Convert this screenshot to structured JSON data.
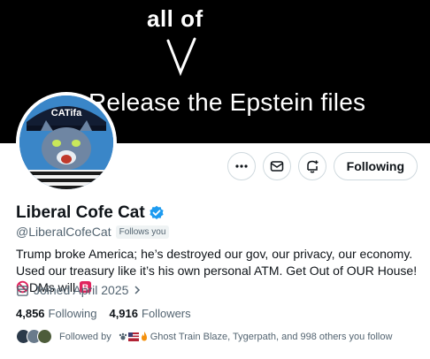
{
  "banner": {
    "top_text": "all of",
    "main_text": "Release the Epstein files"
  },
  "avatar": {
    "cap_text": "CATifa",
    "icon": "cat-avatar"
  },
  "actions": {
    "more_icon": "more-dots-icon",
    "message_icon": "envelope-icon",
    "notify_icon": "bell-plus-icon",
    "follow_label": "Following"
  },
  "profile": {
    "name": "Liberal Cofe Cat",
    "verified_icon": "verified-badge-icon",
    "handle": "@LiberalCofeCat",
    "follows_you": "Follows you",
    "bio_text": "Trump broke America; he’s destroyed our gov, our privacy, our economy. Used our treasury like it’s his own personal ATM. Get Out of OUR House! ",
    "bio_after_icon": "DMs will ",
    "bio_emojis": [
      "prohibited-icon",
      "b-button-icon"
    ],
    "joined": "Joined April 2025",
    "joined_icon": "calendar-icon"
  },
  "stats": {
    "following_count": "4,856",
    "following_label": "Following",
    "followers_count": "4,916",
    "followers_label": "Followers"
  },
  "followed_by": {
    "prefix": "Followed by ",
    "text": "Ghost Train Blaze, Tygerpath, and 998 others you follow"
  },
  "colors": {
    "verified_blue": "#1d9bf0",
    "prohibit_red": "#e0245e",
    "text_secondary": "#536471"
  }
}
